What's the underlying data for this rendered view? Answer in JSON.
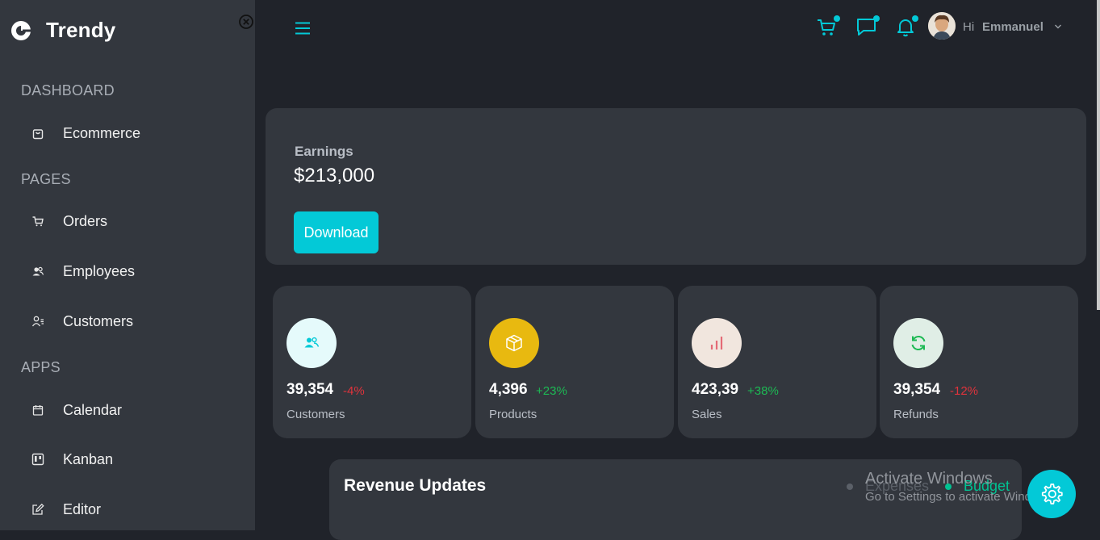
{
  "brand": {
    "name": "Trendy"
  },
  "sidebar": {
    "sections": [
      {
        "title": "DASHBOARD",
        "items": [
          {
            "label": "Ecommerce",
            "icon": "shopping-bag-icon"
          }
        ]
      },
      {
        "title": "PAGES",
        "items": [
          {
            "label": "Orders",
            "icon": "cart-icon"
          },
          {
            "label": "Employees",
            "icon": "employees-icon"
          },
          {
            "label": "Customers",
            "icon": "customers-icon"
          }
        ]
      },
      {
        "title": "APPS",
        "items": [
          {
            "label": "Calendar",
            "icon": "calendar-icon"
          },
          {
            "label": "Kanban",
            "icon": "kanban-icon"
          },
          {
            "label": "Editor",
            "icon": "edit-icon"
          }
        ]
      }
    ]
  },
  "header": {
    "greeting": "Hi",
    "user_name": "Emmanuel"
  },
  "earnings": {
    "label": "Earnings",
    "value": "$213,000",
    "button": "Download"
  },
  "stats": [
    {
      "value": "39,354",
      "change": "-4%",
      "label": "Customers",
      "trend": "down",
      "icon": "users-icon",
      "icon_color": "#03c9d7",
      "icon_bg": "#e5fafb"
    },
    {
      "value": "4,396",
      "change": "+23%",
      "label": "Products",
      "trend": "up",
      "icon": "box-icon",
      "icon_color": "#ffffff",
      "icon_bg": "#e8b910"
    },
    {
      "value": "423,39",
      "change": "+38%",
      "label": "Sales",
      "trend": "up",
      "icon": "bar-chart-icon",
      "icon_color": "#e46a76",
      "icon_bg": "#f1e6de"
    },
    {
      "value": "39,354",
      "change": "-12%",
      "label": "Refunds",
      "trend": "down",
      "icon": "refresh-icon",
      "icon_color": "#1db954",
      "icon_bg": "#e0eee6"
    }
  ],
  "revenue": {
    "title": "Revenue Updates",
    "legend": [
      {
        "label": "Expenses",
        "color": "#5b6068"
      },
      {
        "label": "Budget",
        "color": "#00c292"
      }
    ]
  },
  "watermark": {
    "line1": "Activate Windows",
    "line2": "Go to Settings to activate Windows."
  },
  "colors": {
    "accent": "#03c9d7",
    "sidebar_bg": "#33373e",
    "main_bg": "#20232a",
    "positive": "#1db954",
    "negative": "#e0333c"
  }
}
